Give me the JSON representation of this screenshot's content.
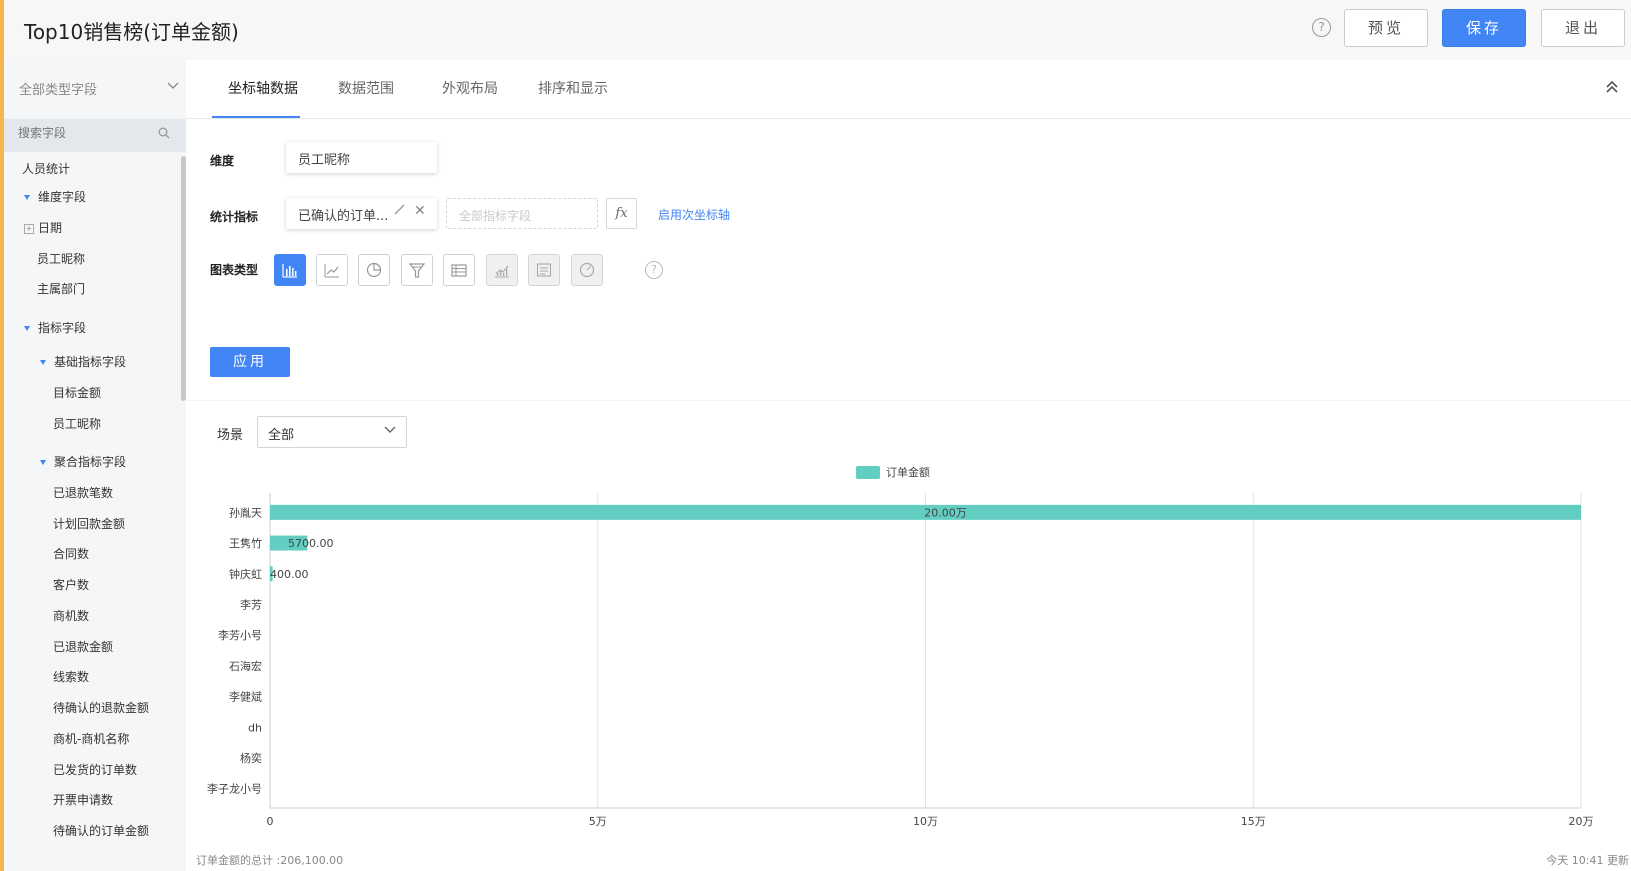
{
  "header": {
    "title": "Top10销售榜(订单金额)",
    "help": "?",
    "preview_label": "预览",
    "save_label": "保存",
    "exit_label": "退出"
  },
  "sidebar": {
    "field_type": "全部类型字段",
    "search_placeholder": "搜索字段",
    "items": [
      {
        "label": "人员统计"
      },
      {
        "label": "维度字段"
      },
      {
        "label": "日期"
      },
      {
        "label": "员工昵称"
      },
      {
        "label": "主属部门"
      },
      {
        "label": "指标字段"
      },
      {
        "label": "基础指标字段"
      },
      {
        "label": "目标金额"
      },
      {
        "label": "员工昵称"
      },
      {
        "label": "聚合指标字段"
      },
      {
        "label": "已退款笔数"
      },
      {
        "label": "计划回款金额"
      },
      {
        "label": "合同数"
      },
      {
        "label": "客户数"
      },
      {
        "label": "商机数"
      },
      {
        "label": "已退款金额"
      },
      {
        "label": "线索数"
      },
      {
        "label": "待确认的退款金额"
      },
      {
        "label": "商机-商机名称"
      },
      {
        "label": "已发货的订单数"
      },
      {
        "label": "开票申请数"
      },
      {
        "label": "待确认的订单金额"
      }
    ]
  },
  "tabs": [
    "坐标轴数据",
    "数据范围",
    "外观布局",
    "排序和显示"
  ],
  "config": {
    "dimension_label": "维度",
    "dimension_value": "员工昵称",
    "metric_label": "统计指标",
    "metric_value": "已确认的订单...",
    "metric_placeholder": "全部指标字段",
    "fx_label": "fx",
    "secondary_axis": "启用次坐标轴",
    "chart_type_label": "图表类型",
    "chart_types": [
      "bar",
      "line",
      "pie",
      "funnel",
      "table",
      "area",
      "text",
      "gauge"
    ],
    "help": "?",
    "apply_label": "应用"
  },
  "scene": {
    "label": "场景",
    "value": "全部"
  },
  "chart_data": {
    "type": "bar",
    "orientation": "horizontal",
    "legend": [
      "订单金额"
    ],
    "color": "#62cdc1",
    "categories": [
      "孙胤天",
      "王隽竹",
      "钟庆虹",
      "李芳",
      "李芳小号",
      "石海宏",
      "李健斌",
      "dh",
      "杨奕",
      "李子龙小号"
    ],
    "values": [
      200000,
      5700,
      400,
      0,
      0,
      0,
      0,
      0,
      0,
      0
    ],
    "data_labels": [
      "20.00万",
      "5700.00",
      "400.00",
      "",
      "",
      "",
      "",
      "",
      "",
      ""
    ],
    "x_ticks": [
      {
        "value": 0,
        "label": "0"
      },
      {
        "value": 50000,
        "label": "5万"
      },
      {
        "value": 100000,
        "label": "10万"
      },
      {
        "value": 150000,
        "label": "15万"
      },
      {
        "value": 200000,
        "label": "20万"
      }
    ],
    "xlim": [
      0,
      200000
    ],
    "grid": true
  },
  "footer": {
    "total": "订单金额的总计 :206,100.00",
    "updated": "今天 10:41 更新"
  }
}
